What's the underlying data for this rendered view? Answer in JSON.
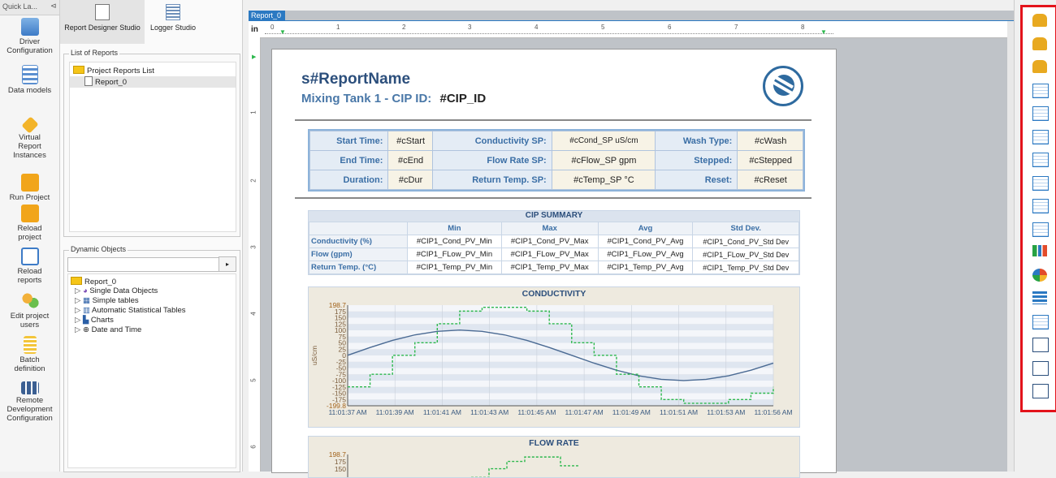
{
  "quick_launch": {
    "title": "Quick La...",
    "items": [
      {
        "label": "Driver Configuration",
        "icon": "database-icon"
      },
      {
        "label": "Data models",
        "icon": "data-models-icon"
      },
      {
        "label": "Virtual Report Instances",
        "icon": "tag-icon"
      },
      {
        "label": "Run Project",
        "icon": "run-icon"
      },
      {
        "label": "Reload project",
        "icon": "reload-project-icon"
      },
      {
        "label": "Reload reports",
        "icon": "reload-reports-icon"
      },
      {
        "label": "Edit project users",
        "icon": "users-icon"
      },
      {
        "label": "Batch definition",
        "icon": "batch-icon"
      },
      {
        "label": "Remote Development Configuration",
        "icon": "remote-icon"
      }
    ]
  },
  "studio_tabs": {
    "report_designer": "Report Designer Studio",
    "logger": "Logger Studio"
  },
  "reports": {
    "legend": "List of Reports",
    "root": "Project Reports List",
    "items": [
      "Report_0"
    ]
  },
  "dynamic": {
    "legend": "Dynamic Objects",
    "search_value": "",
    "root": "Report_0",
    "items": [
      "Single Data Objects",
      "Simple tables",
      "Automatic Statistical Tables",
      "Charts",
      "Date and Time"
    ]
  },
  "designer": {
    "tab": "Report_0",
    "ruler_unit": "in",
    "ruler_ticks": [
      "0",
      "1",
      "2",
      "3",
      "4",
      "5",
      "6",
      "7",
      "8"
    ],
    "left_ticks": [
      "1",
      "2",
      "3",
      "4",
      "5",
      "6"
    ]
  },
  "report": {
    "name": "s#ReportName",
    "subtitle_prefix": "Mixing Tank 1 - CIP ID:",
    "subtitle_value": "#CIP_ID",
    "info_rows": [
      [
        "Start Time:",
        "#cStart",
        "Conductivity SP:",
        "#cCond_SP uS/cm",
        "Wash Type:",
        "#cWash"
      ],
      [
        "End Time:",
        "#cEnd",
        "Flow Rate SP:",
        "#cFlow_SP gpm",
        "Stepped:",
        "#cStepped"
      ],
      [
        "Duration:",
        "#cDur",
        "Return Temp. SP:",
        "#cTemp_SP °C",
        "Reset:",
        "#cReset"
      ]
    ],
    "summary": {
      "title": "CIP SUMMARY",
      "headers": [
        "",
        "Min",
        "Max",
        "Avg",
        "Std Dev."
      ],
      "rows": [
        [
          "Conductivity (%)",
          "#CIP1_Cond_PV_Min",
          "#CIP1_Cond_PV_Max",
          "#CIP1_Cond_PV_Avg",
          "#CIP1_Cond_PV_Std Dev"
        ],
        [
          "Flow (gpm)",
          "#CIP1_FLow_PV_Min",
          "#CIP1_FLow_PV_Max",
          "#CIP1_FLow_PV_Avg",
          "#CIP1_FLow_PV_Std Dev"
        ],
        [
          "Return Temp. (°C)",
          "#CIP1_Temp_PV_Min",
          "#CIP1_Temp_PV_Max",
          "#CIP1_Temp_PV_Avg",
          "#CIP1_Temp_PV_Std Dev"
        ]
      ]
    }
  },
  "chart_data": [
    {
      "type": "line",
      "title": "CONDUCTIVITY",
      "ylabel": "uS/cm",
      "xlabel": "",
      "ylim": [
        -199.8,
        198.7
      ],
      "y_ticks": [
        "198.7",
        "175",
        "150",
        "125",
        "100",
        "75",
        "50",
        "25",
        "0",
        "-25",
        "-50",
        "-75",
        "-100",
        "-125",
        "-150",
        "-175",
        "-199.8"
      ],
      "x_ticks": [
        "11:01:37 AM",
        "11:01:39 AM",
        "11:01:41 AM",
        "11:01:43 AM",
        "11:01:45 AM",
        "11:01:47 AM",
        "11:01:49 AM",
        "11:01:51 AM",
        "11:01:53 AM",
        "11:01:56 AM"
      ],
      "grid": true,
      "series": [
        {
          "name": "",
          "style": "solid",
          "color": "#4a6a93",
          "x": [
            0,
            1,
            2,
            3,
            4,
            5,
            6,
            7,
            8,
            9,
            10,
            11,
            12,
            13,
            14,
            15,
            16,
            17,
            18,
            19
          ],
          "y": [
            0,
            31,
            59,
            81,
            95,
            100,
            95,
            81,
            59,
            31,
            0,
            -31,
            -59,
            -81,
            -95,
            -100,
            -95,
            -81,
            -59,
            -31
          ]
        },
        {
          "name": "",
          "style": "dashed",
          "color": "#2db84d",
          "x": [
            0,
            1,
            2,
            3,
            4,
            5,
            6,
            7,
            8,
            9,
            10,
            11,
            12,
            13,
            14,
            15,
            16,
            17,
            18,
            19
          ],
          "y": [
            -125,
            -75,
            0,
            50,
            125,
            175,
            190,
            190,
            175,
            125,
            50,
            0,
            -75,
            -125,
            -175,
            -190,
            -190,
            -175,
            -150,
            -125
          ]
        }
      ]
    },
    {
      "type": "line",
      "title": "FLOW RATE",
      "ylabel": "",
      "ylim": [
        0,
        198.7
      ],
      "y_ticks": [
        "198.7",
        "175",
        "150"
      ],
      "series": [
        {
          "name": "",
          "style": "dashed",
          "color": "#2db84d",
          "x": [
            0,
            1,
            2,
            3,
            4,
            5
          ],
          "y": [
            120,
            150,
            175,
            190,
            190,
            160
          ]
        }
      ]
    }
  ],
  "toolbox": {
    "items": [
      "tag-function-icon",
      "tag-list-icon",
      "tag-math-icon",
      "table-icon",
      "table-warning-icon",
      "table-sql-icon",
      "table-clock-icon",
      "table-header-icon",
      "grid-icon",
      "trend-chart-icon",
      "bar-chart-icon",
      "pie-chart-icon",
      "horizontal-bar-icon",
      "calendar-table-icon",
      "page-number-icon",
      "counter-icon",
      "line-tool-icon"
    ],
    "accent": "#e3131b"
  }
}
